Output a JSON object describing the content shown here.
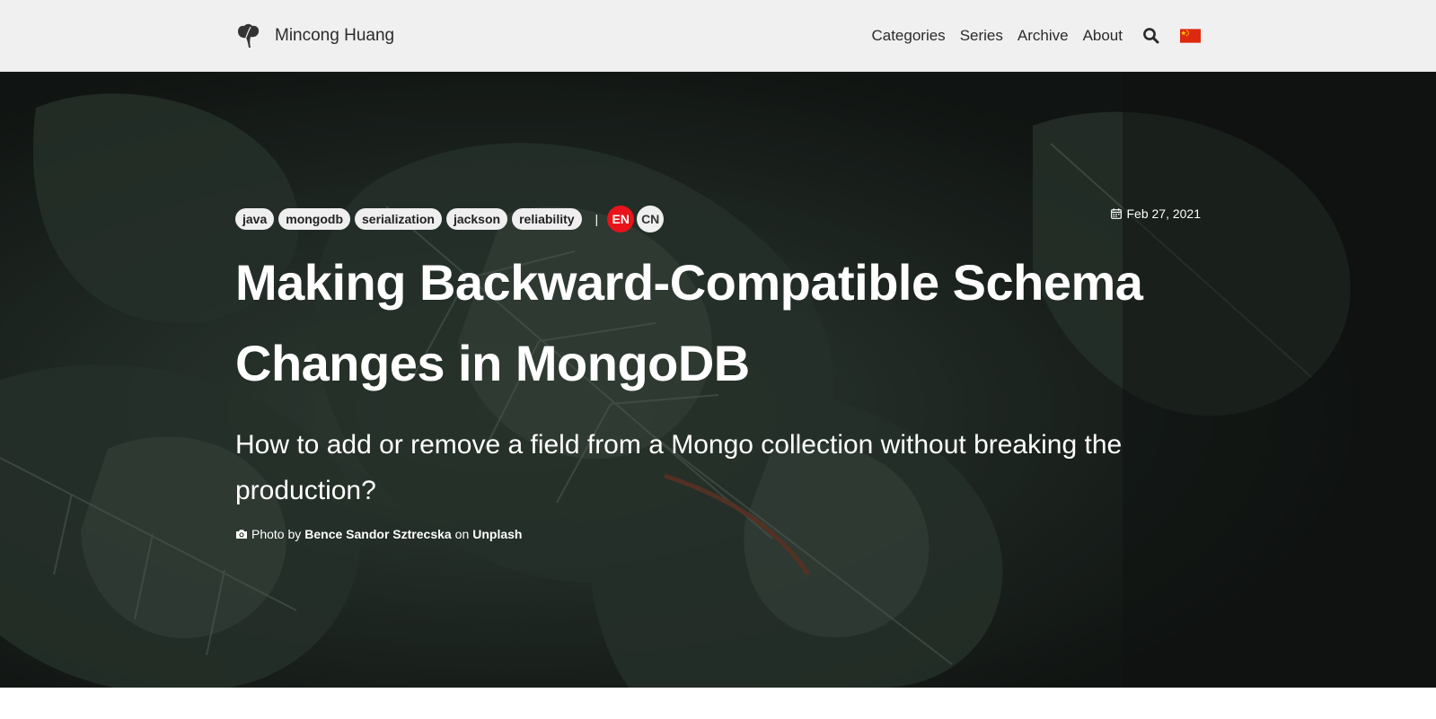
{
  "navbar": {
    "brand_name": "Mincong Huang",
    "links": [
      "Categories",
      "Series",
      "Archive",
      "About"
    ],
    "search_icon": "search-icon",
    "flag_icon": "china-flag-icon"
  },
  "hero": {
    "tags": [
      "java",
      "mongodb",
      "serialization",
      "jackson",
      "reliability"
    ],
    "separator": "|",
    "languages": {
      "en": "EN",
      "cn": "CN"
    },
    "date": "Feb 27, 2021",
    "title": "Making Backward-Compatible Schema Changes in MongoDB",
    "subtitle": "How to add or remove a field from a Mongo collection without breaking the production?",
    "credit": {
      "prefix": "Photo by",
      "author": "Bence Sandor Sztrecska",
      "middle": "on",
      "source": "Unplash"
    }
  },
  "colors": {
    "navbar_bg": "#f0f0f0",
    "tag_bg": "#efefef",
    "lang_active": "#e8131b",
    "hero_dark": "#1a201c"
  }
}
